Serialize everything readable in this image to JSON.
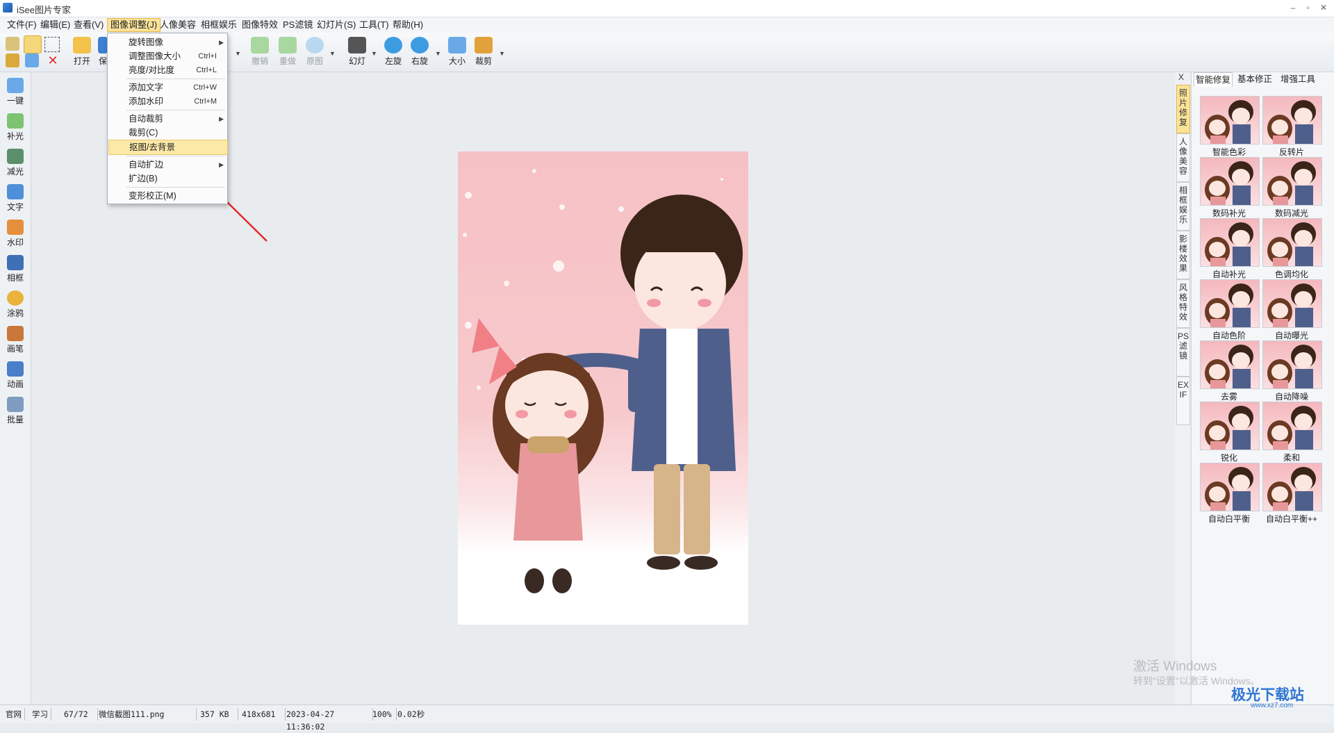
{
  "window": {
    "title": "iSee图片专家",
    "min": "–",
    "max": "▫",
    "close": "✕"
  },
  "menu": [
    "文件(F)",
    "编辑(E)",
    "查看(V)",
    "图像调整(J)",
    "人像美容",
    "相框娱乐",
    "图像特效",
    "PS滤镜",
    "幻灯片(S)",
    "工具(T)",
    "帮助(H)"
  ],
  "toolbar": {
    "open": "打开",
    "save_partial": "保",
    "undo": "撤销",
    "redo": "重做",
    "original": "原图",
    "slideshow": "幻灯",
    "rotate_left": "左旋",
    "rotate_right": "右旋",
    "resize": "大小",
    "crop": "裁剪"
  },
  "dropdown": {
    "items": [
      {
        "label": "旋转图像",
        "shortcut": "",
        "submenu": true
      },
      {
        "label": "调整图像大小",
        "shortcut": "Ctrl+I",
        "submenu": false
      },
      {
        "label": "亮度/对比度",
        "shortcut": "Ctrl+L",
        "submenu": false
      },
      {
        "label": "添加文字",
        "shortcut": "Ctrl+W",
        "submenu": false
      },
      {
        "label": "添加水印",
        "shortcut": "Ctrl+M",
        "submenu": false
      },
      {
        "label": "自动裁剪",
        "shortcut": "",
        "submenu": true
      },
      {
        "label": "裁剪(C)",
        "shortcut": "",
        "submenu": false
      },
      {
        "label": "抠图/去背景",
        "shortcut": "",
        "submenu": false,
        "highlighted": true
      },
      {
        "label": "自动扩边",
        "shortcut": "",
        "submenu": true
      },
      {
        "label": "扩边(B)",
        "shortcut": "",
        "submenu": false
      },
      {
        "label": "变形校正(M)",
        "shortcut": "",
        "submenu": false
      }
    ]
  },
  "left_tools": [
    "一键",
    "补光",
    "减光",
    "文字",
    "水印",
    "相框",
    "涂鸦",
    "画笔",
    "动画",
    "批量"
  ],
  "side_tabs": [
    "照片修复",
    "人像美容",
    "相框娱乐",
    "影楼效果",
    "风格特效",
    "PS滤镜",
    "EXIF"
  ],
  "side_close": "X",
  "right_panel": {
    "tabs": [
      "智能修复",
      "基本修正",
      "增强工具"
    ],
    "thumbs": [
      "智能色彩",
      "反转片",
      "数码补光",
      "数码减光",
      "自动补光",
      "色调均化",
      "自动色阶",
      "自动曝光",
      "去雾",
      "自动降噪",
      "锐化",
      "柔和",
      "自动白平衡",
      "自动白平衡++"
    ]
  },
  "status": {
    "official": "官网",
    "learn": "学习",
    "index": "67/72",
    "filename": "微信截图111.png",
    "size": "357 KB",
    "dims": "418x681",
    "datetime": "2023-04-27 11:36:02",
    "zoom": "100%",
    "time": "0.02秒"
  },
  "watermark": {
    "line1": "激活 Windows",
    "line2": "转到\"设置\"以激活 Windows。"
  },
  "logo": {
    "text": "极光下载站",
    "sub": "www.xz7.com"
  },
  "colors": {
    "menu_highlight": "#fbe39a",
    "accent_red_arrow": "#e0282c"
  }
}
